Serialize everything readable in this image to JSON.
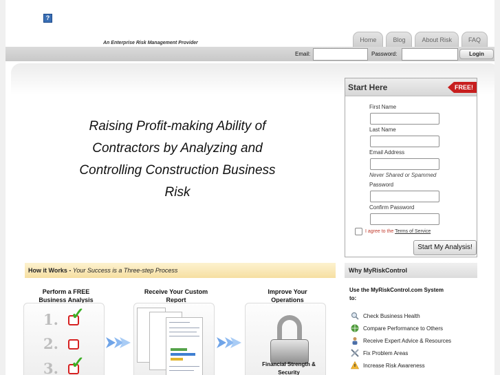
{
  "header": {
    "logo_icon": "?",
    "tagline": "An Enterprise Risk Management Provider",
    "tabs": [
      "Home",
      "Blog",
      "About Risk",
      "FAQ"
    ]
  },
  "login_bar": {
    "email_label": "Email:",
    "password_label": "Password:",
    "login_button": "Login"
  },
  "hero": {
    "headline": "Raising Profit-making Ability of Contractors by Analyzing and Controlling Construction Business Risk"
  },
  "signup": {
    "title": "Start Here",
    "badge": "FREE!",
    "first_name": "First Name",
    "last_name": "Last Name",
    "email": "Email Address",
    "email_note": "Never Shared or Spammed",
    "password": "Password",
    "confirm_password": "Confirm Password",
    "agree_text": "I agree to the",
    "tos_link": "Terms of Service",
    "submit": "Start My Analysis!"
  },
  "how": {
    "title": "How it Works -",
    "subtitle": "Your Success is a Three-step Process",
    "steps": [
      {
        "title": "Perform a FREE Business Analysis"
      },
      {
        "title": "Receive Your Custom Report"
      },
      {
        "title": "Improve Your Operations",
        "caption": "Financial Strength & Security"
      }
    ],
    "numbers": [
      "1.",
      "2.",
      "3."
    ]
  },
  "why": {
    "title": "Why MyRiskControl",
    "intro": "Use the MyRiskControl.com System to:",
    "items": [
      {
        "label": "Check Business Health",
        "icon": "magnifier-icon"
      },
      {
        "label": "Compare Performance to Others",
        "icon": "globe-icon"
      },
      {
        "label": "Receive Expert Advice & Resources",
        "icon": "person-icon"
      },
      {
        "label": "Fix Problem Areas",
        "icon": "tools-icon"
      },
      {
        "label": "Increase Risk Awareness",
        "icon": "warning-icon"
      }
    ]
  },
  "colors": {
    "accent_red": "#c71e1e",
    "check_green": "#3cae25",
    "how_bar": "#f6dfa2",
    "arrow_blue": "#6fa4e8"
  }
}
